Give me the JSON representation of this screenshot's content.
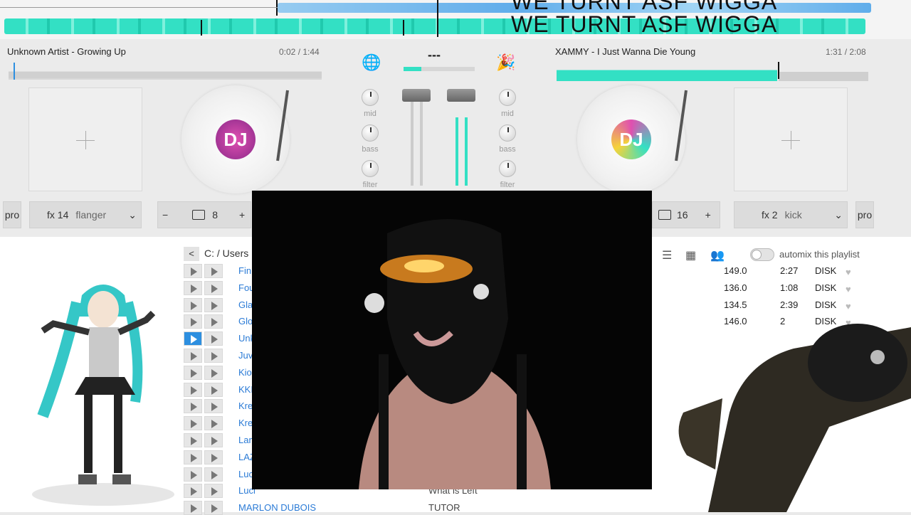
{
  "banner": {
    "line1": "WE TURNT ASF WIGGA",
    "line2": "WE TURNT ASF WIGGA"
  },
  "colors": {
    "wave": "#33e0c4",
    "wave_blue": "#3b9be8",
    "link": "#2b7bd6",
    "active": "#2d8fe0"
  },
  "deck_left": {
    "title": "Unknown Artist - Growing Up",
    "time": "0:02 / 1:44",
    "fx_num": "fx 14",
    "fx_name": "flanger",
    "loop": "8",
    "pro": "pro",
    "minus": "−",
    "plus": "+"
  },
  "deck_right": {
    "title": "XAMMY - I Just Wanna Die Young",
    "time": "1:31 / 2:08",
    "fx_num": "fx 2",
    "fx_name": "kick",
    "loop": "16",
    "pro": "pro",
    "plus": "+"
  },
  "mixer": {
    "bpm_display": "---",
    "knobs": [
      "mid",
      "bass",
      "filter"
    ],
    "left_icon": "globe-icon",
    "right_icon": "party-popper-icon"
  },
  "platter_labels": {
    "left": "DJ",
    "right": "DJ"
  },
  "browser": {
    "back_label": "<",
    "path": "C: / Users",
    "automix": "automix this playlist",
    "tracks": [
      {
        "name": "Fin"
      },
      {
        "name": "Fou"
      },
      {
        "name": "Gla"
      },
      {
        "name": "Glo"
      },
      {
        "name": "Unk",
        "active": true
      },
      {
        "name": "Juv"
      },
      {
        "name": "Kio"
      },
      {
        "name": "KKI"
      },
      {
        "name": "Kre"
      },
      {
        "name": "Kre"
      },
      {
        "name": "Lan"
      },
      {
        "name": "LAZ"
      },
      {
        "name": "Luc"
      },
      {
        "name": "Luci",
        "extra": "What is Left"
      },
      {
        "name": "MARLON DUBOIS",
        "extra": "TUTOR"
      }
    ],
    "right_rows": [
      {
        "bpm": "149.0",
        "len": "2:27",
        "src": "DISK"
      },
      {
        "bpm": "136.0",
        "len": "1:08",
        "src": "DISK"
      },
      {
        "bpm": "134.5",
        "len": "2:39",
        "src": "DISK"
      },
      {
        "bpm": "146.0",
        "len": "2",
        "src": "DISK"
      }
    ]
  }
}
